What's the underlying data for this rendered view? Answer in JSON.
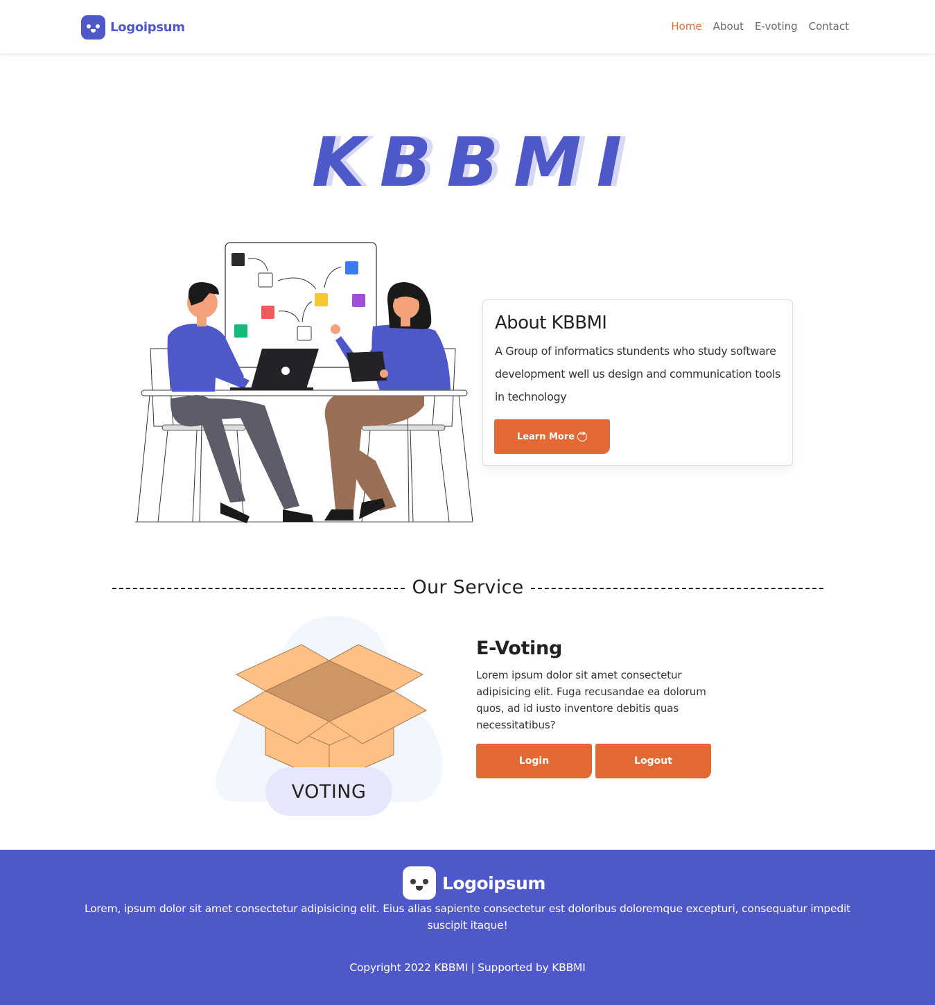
{
  "nav": {
    "brand": "Logoipsum",
    "links": [
      {
        "label": "Home",
        "active": true
      },
      {
        "label": "About",
        "active": false
      },
      {
        "label": "E-voting",
        "active": false
      },
      {
        "label": "Contact",
        "active": false
      }
    ]
  },
  "hero": {
    "title": "KBBMI"
  },
  "about": {
    "title": "About KBBMI",
    "text": "A Group of informatics stundents who study software development well us design and communication tools in technology",
    "button": "Learn More"
  },
  "service": {
    "heading": "Our Service",
    "illustration_label": "VOTING",
    "title": "E-Voting",
    "text": "Lorem ipsum dolor sit amet consectetur adipisicing elit. Fuga recusandae ea dolorum quos, ad id iusto inventore debitis quas necessitatibus?",
    "login": "Login",
    "logout": "Logout"
  },
  "footer": {
    "brand": "Logoipsum",
    "description": "Lorem, ipsum dolor sit amet consectetur adipisicing elit. Eius alias sapiente consectetur est doloribus doloremque excepturi, consequatur impedit suscipit itaque!",
    "copyright": "Copyright 2022 KBBMI | Supported by KBBMI"
  },
  "colors": {
    "primary": "#4f58c9",
    "accent": "#e26834",
    "box": "#ffc085"
  }
}
